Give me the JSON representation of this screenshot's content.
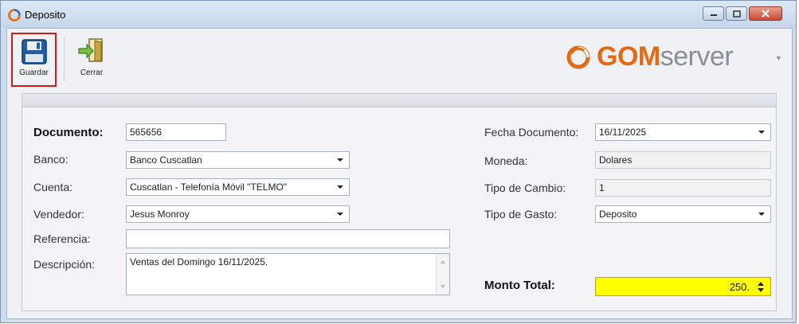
{
  "window": {
    "title": "Deposito"
  },
  "toolbar": {
    "save_label": "Guardar",
    "close_label": "Cerrar"
  },
  "logo": {
    "brand_a": "GOM",
    "brand_b": "server"
  },
  "form": {
    "documento": {
      "label": "Documento:",
      "value": "565656"
    },
    "banco": {
      "label": "Banco:",
      "value": "Banco Cuscatlan"
    },
    "cuenta": {
      "label": "Cuenta:",
      "value": "Cuscatlan - Telefonía Móvil \"TELMO\""
    },
    "vendedor": {
      "label": "Vendedor:",
      "value": "Jesus Monroy"
    },
    "referencia": {
      "label": "Referencia:",
      "value": ""
    },
    "descripcion": {
      "label": "Descripción:",
      "value": "Ventas del Domingo 16/11/2025."
    },
    "fecha_documento": {
      "label": "Fecha Documento:",
      "value": "16/11/2025"
    },
    "moneda": {
      "label": "Moneda:",
      "value": "Dolares"
    },
    "tipo_cambio": {
      "label": "Tipo de Cambio:",
      "value": "1"
    },
    "tipo_gasto": {
      "label": "Tipo de Gasto:",
      "value": "Deposito"
    },
    "monto_total": {
      "label": "Monto Total:",
      "value": "250."
    }
  },
  "colors": {
    "accent_orange": "#e36a12",
    "save_highlight": "#d01b1b",
    "monto_background": "#ffff00",
    "close_button": "#c74b34"
  },
  "icons": [
    "app-logo-icon",
    "floppy-disk-icon",
    "exit-door-icon",
    "minimize-icon",
    "maximize-icon",
    "close-icon"
  ]
}
